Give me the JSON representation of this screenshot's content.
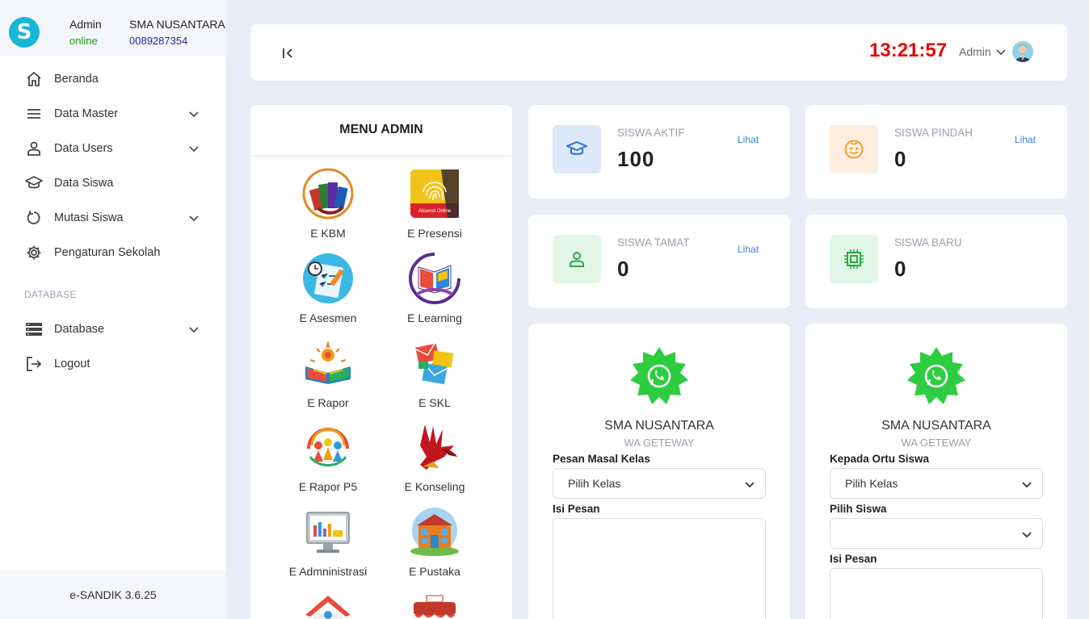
{
  "sidebar": {
    "user_name": "Admin",
    "user_status": "online",
    "school_name": "SMA NUSANTARA",
    "school_npsn": "0089287354",
    "items": [
      {
        "label": "Beranda"
      },
      {
        "label": "Data Master"
      },
      {
        "label": "Data Users"
      },
      {
        "label": "Data Siswa"
      },
      {
        "label": "Mutasi Siswa"
      },
      {
        "label": "Pengaturan Sekolah"
      }
    ],
    "section_label": "DATABASE",
    "db_items": [
      {
        "label": "Database"
      },
      {
        "label": "Logout"
      }
    ],
    "footer": "e-SANDIK 3.6.25"
  },
  "topbar": {
    "clock": "13:21:57",
    "user_label": "Admin"
  },
  "menu": {
    "title": "MENU ADMIN",
    "apps": [
      {
        "label": "E KBM",
        "icon": "books-icon"
      },
      {
        "label": "E Presensi",
        "icon": "fingerprint-icon"
      },
      {
        "label": "E Asesmen",
        "icon": "checklist-icon"
      },
      {
        "label": "E Learning",
        "icon": "open-book-icon"
      },
      {
        "label": "E Rapor",
        "icon": "rapor-book-icon"
      },
      {
        "label": "E SKL",
        "icon": "envelopes-icon"
      },
      {
        "label": "E Rapor P5",
        "icon": "people-circle-icon"
      },
      {
        "label": "E Konseling",
        "icon": "hand-bird-icon"
      },
      {
        "label": "E Admninistrasi",
        "icon": "monitor-chart-icon"
      },
      {
        "label": "E Pustaka",
        "icon": "library-building-icon"
      }
    ]
  },
  "stats": [
    {
      "title": "SISWA AKTIF",
      "value": "100",
      "link": "Lihat",
      "color": "#3b82d6"
    },
    {
      "title": "SISWA PINDAH",
      "value": "0",
      "link": "Lihat",
      "color": "#f39c24"
    },
    {
      "title": "SISWA TAMAT",
      "value": "0",
      "link": "Lihat",
      "color": "#28a745"
    },
    {
      "title": "SISWA BARU",
      "value": "0",
      "color": "#28a745"
    }
  ],
  "wa_cards": [
    {
      "title": "SMA NUSANTARA",
      "subtitle": "WA GETEWAY",
      "field1_label": "Pesan Masal Kelas",
      "field1_value": "Pilih Kelas",
      "field2_label": "Isi Pesan"
    },
    {
      "title": "SMA NUSANTARA",
      "subtitle": "WA GETEWAY",
      "field1_label": "Kepada Ortu Siswa",
      "field1_value": "Pilih Kelas",
      "field2_label": "Pilih Siswa",
      "field2_value": "",
      "field3_label": "Isi Pesan"
    }
  ]
}
